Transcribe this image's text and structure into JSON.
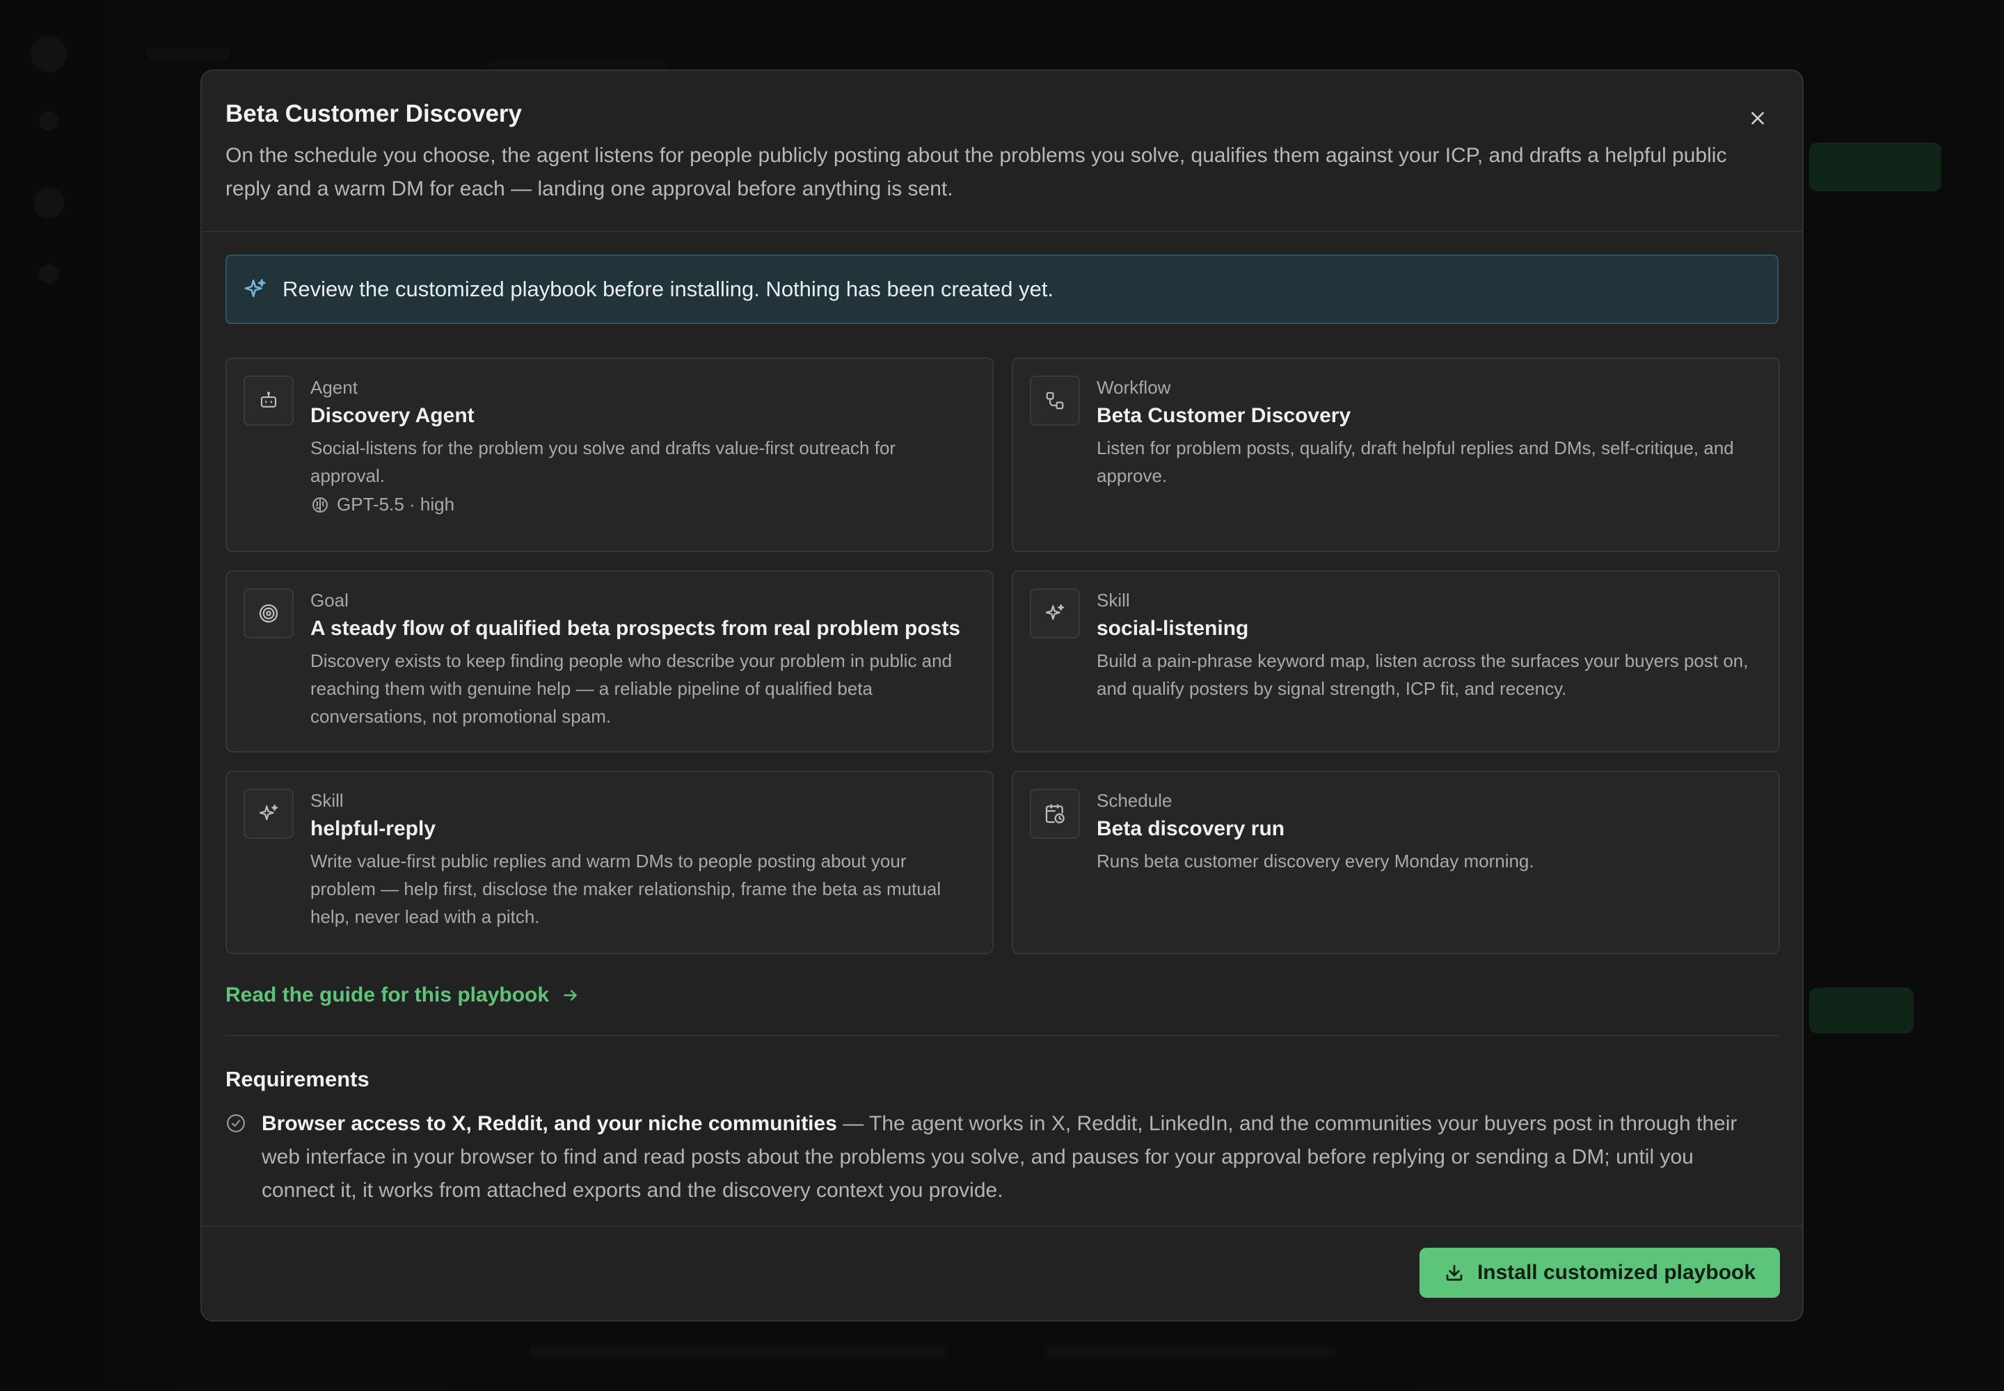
{
  "modal": {
    "title": "Beta Customer Discovery",
    "description": "On the schedule you choose, the agent listens for people publicly posting about the problems you solve, qualifies them against your ICP, and drafts a helpful public reply and a warm DM for each — landing one approval before anything is sent.",
    "close_icon": "close-icon"
  },
  "notice": {
    "text": "Review the customized playbook before installing. Nothing has been created yet.",
    "icon": "sparkle-icon"
  },
  "cards": [
    {
      "kind": "Agent",
      "title": "Discovery Agent",
      "description": "Social-listens for the problem you solve and drafts value-first outreach for approval.",
      "meta": "GPT-5.5 · high",
      "icon": "robot-icon"
    },
    {
      "kind": "Workflow",
      "title": "Beta Customer Discovery",
      "description": "Listen for problem posts, qualify, draft helpful replies and DMs, self-critique, and approve.",
      "icon": "workflow-icon"
    },
    {
      "kind": "Goal",
      "title": "A steady flow of qualified beta prospects from real problem posts",
      "description": "Discovery exists to keep finding people who describe your problem in public and reaching them with genuine help — a reliable pipeline of qualified beta conversations, not promotional spam.",
      "icon": "target-icon"
    },
    {
      "kind": "Skill",
      "title": "social-listening",
      "description": "Build a pain-phrase keyword map, listen across the surfaces your buyers post on, and qualify posters by signal strength, ICP fit, and recency.",
      "icon": "sparkle-icon"
    },
    {
      "kind": "Skill",
      "title": "helpful-reply",
      "description": "Write value-first public replies and warm DMs to people posting about your problem — help first, disclose the maker relationship, frame the beta as mutual help, never lead with a pitch.",
      "icon": "sparkle-icon"
    },
    {
      "kind": "Schedule",
      "title": "Beta discovery run",
      "description": "Runs beta customer discovery every Monday morning.",
      "icon": "calendar-clock-icon"
    }
  ],
  "guide_link": "Read the guide for this playbook",
  "requirements": {
    "title": "Requirements",
    "items": [
      {
        "name": "Browser access to X, Reddit, and your niche communities",
        "detail": " — The agent works in X, Reddit, LinkedIn, and the communities your buyers post in through their web interface in your browser to find and read posts about the problems you solve, and pauses for your approval before replying or sending a DM; until you connect it, it works from attached exports and the discovery context you provide."
      }
    ]
  },
  "footer": {
    "install_label": "Install customized playbook",
    "install_icon": "download-icon"
  },
  "colors": {
    "accent": "#5cc57a",
    "modal_bg": "#222222",
    "notice_bg": "#22333a",
    "notice_icon": "#6fb8e0"
  }
}
